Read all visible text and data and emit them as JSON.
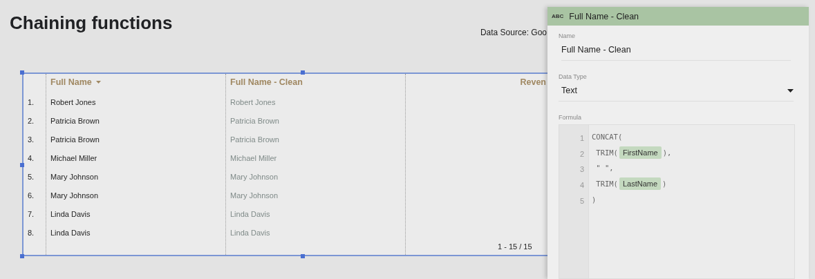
{
  "report": {
    "title": "Chaining functions",
    "data_source": "Data Source: Goo"
  },
  "table": {
    "columns": [
      {
        "label": "Full Name",
        "sorted": true
      },
      {
        "label": "Full Name - Clean",
        "sorted": false
      },
      {
        "label": "Reven",
        "sorted": false
      }
    ],
    "rows": [
      {
        "index": "1.",
        "cells": [
          "Robert Jones",
          "Robert Jones"
        ]
      },
      {
        "index": "2.",
        "cells": [
          "Patricia Brown",
          "Patricia Brown"
        ]
      },
      {
        "index": "3.",
        "cells": [
          "Patricia Brown",
          "Patricia Brown"
        ]
      },
      {
        "index": "4.",
        "cells": [
          "Michael Miller",
          "Michael Miller"
        ]
      },
      {
        "index": "5.",
        "cells": [
          "Mary Johnson",
          "Mary Johnson"
        ]
      },
      {
        "index": "6.",
        "cells": [
          "Mary Johnson",
          "Mary Johnson"
        ]
      },
      {
        "index": "7.",
        "cells": [
          "Linda Davis",
          "Linda Davis"
        ]
      },
      {
        "index": "8.",
        "cells": [
          "Linda Davis",
          "Linda Davis"
        ]
      }
    ],
    "pagination": "1 - 15 / 15"
  },
  "panel": {
    "type_badge": "ABC",
    "title": "Full Name - Clean",
    "name_label": "Name",
    "name_value": "Full Name - Clean",
    "type_label": "Data Type",
    "type_value": "Text",
    "formula_label": "Formula",
    "formula_lines": [
      {
        "number": "1",
        "parts": [
          {
            "kind": "text",
            "text": "CONCAT("
          }
        ]
      },
      {
        "number": "2",
        "parts": [
          {
            "kind": "text",
            "text": " TRIM("
          },
          {
            "kind": "field",
            "text": "FirstName"
          },
          {
            "kind": "text",
            "text": "),"
          }
        ]
      },
      {
        "number": "3",
        "parts": [
          {
            "kind": "text",
            "text": " \" \","
          }
        ]
      },
      {
        "number": "4",
        "parts": [
          {
            "kind": "text",
            "text": " TRIM("
          },
          {
            "kind": "field",
            "text": "LastName"
          },
          {
            "kind": "text",
            "text": ")"
          }
        ]
      },
      {
        "number": "5",
        "parts": [
          {
            "kind": "text",
            "text": ")"
          }
        ]
      }
    ]
  }
}
